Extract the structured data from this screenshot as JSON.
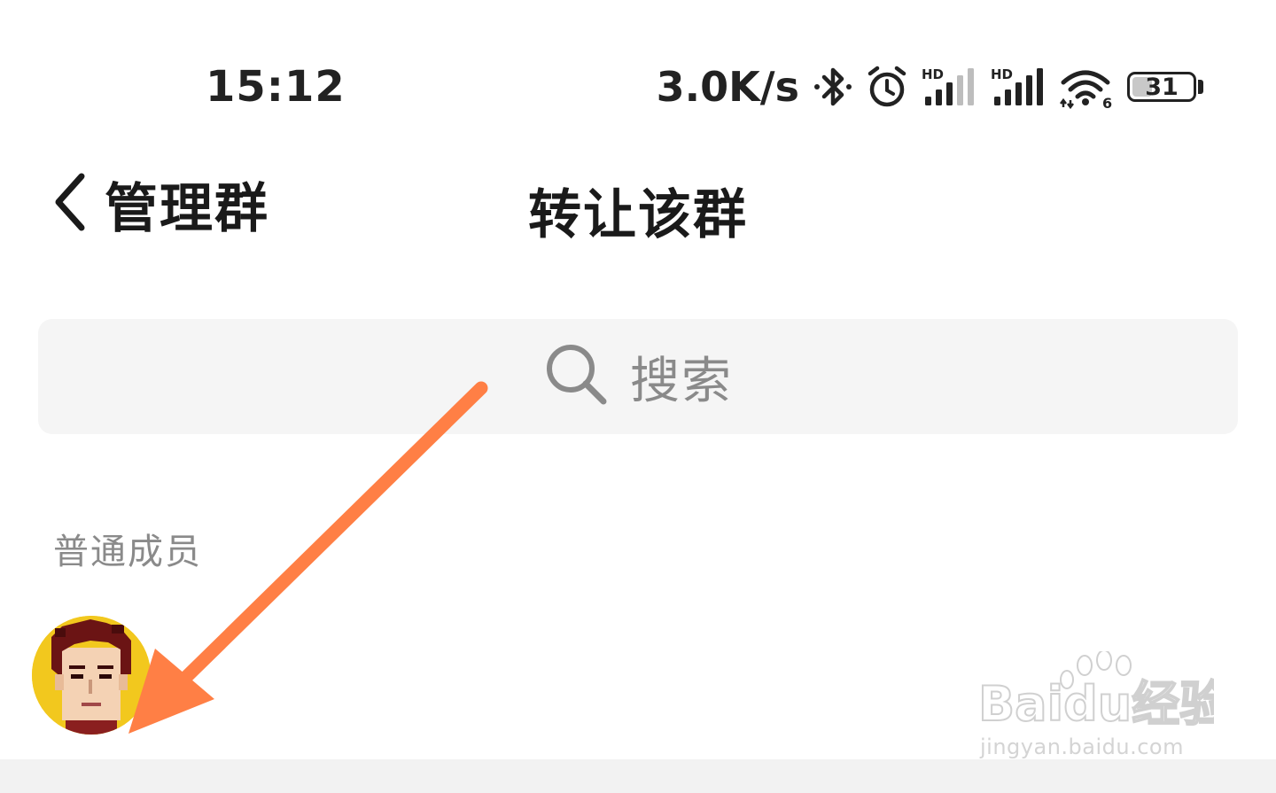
{
  "status_bar": {
    "time": "15:12",
    "net_speed": "3.0K/s",
    "battery_level": "31",
    "icons": [
      "bluetooth-icon",
      "alarm-icon",
      "signal-hd-icon",
      "signal-hd-icon",
      "wifi-icon",
      "battery-icon"
    ],
    "signal_label_1": "HD",
    "signal_label_2": "HD",
    "wifi_label": "6"
  },
  "nav": {
    "back_label": "管理群",
    "title": "转让该群"
  },
  "search": {
    "placeholder": "搜索"
  },
  "members_section": {
    "header": "普通成员"
  },
  "watermark": {
    "brand": "Baidu经验",
    "url": "jingyan.baidu.com"
  },
  "colors": {
    "accent_arrow": "#ff7f45",
    "search_bg": "#f5f5f5",
    "avatar_bg": "#f2c81e",
    "muted_text": "#8a8a8a"
  }
}
